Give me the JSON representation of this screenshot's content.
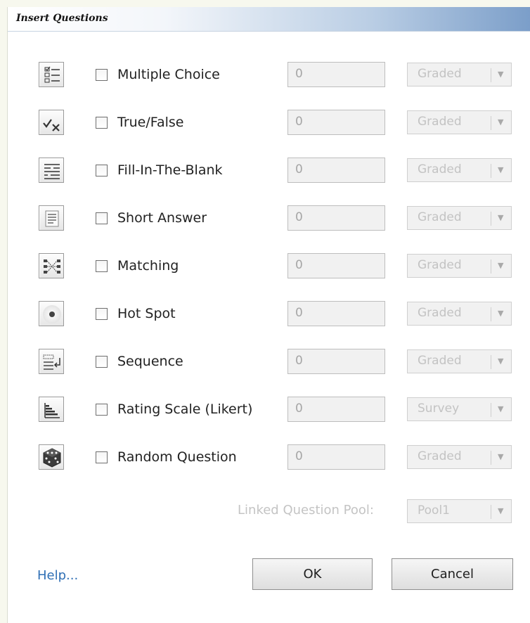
{
  "window": {
    "title": "Insert Questions"
  },
  "questions": [
    {
      "label": "Multiple Choice",
      "count": "0",
      "mode": "Graded",
      "icon": "multiple-choice-icon"
    },
    {
      "label": "True/False",
      "count": "0",
      "mode": "Graded",
      "icon": "true-false-icon"
    },
    {
      "label": "Fill-In-The-Blank",
      "count": "0",
      "mode": "Graded",
      "icon": "fill-in-the-blank-icon"
    },
    {
      "label": "Short Answer",
      "count": "0",
      "mode": "Graded",
      "icon": "short-answer-icon"
    },
    {
      "label": "Matching",
      "count": "0",
      "mode": "Graded",
      "icon": "matching-icon"
    },
    {
      "label": "Hot Spot",
      "count": "0",
      "mode": "Graded",
      "icon": "hot-spot-icon"
    },
    {
      "label": "Sequence",
      "count": "0",
      "mode": "Graded",
      "icon": "sequence-icon"
    },
    {
      "label": "Rating Scale (Likert)",
      "count": "0",
      "mode": "Survey",
      "icon": "rating-scale-icon"
    },
    {
      "label": "Random Question",
      "count": "0",
      "mode": "Graded",
      "icon": "random-dice-icon"
    }
  ],
  "pool": {
    "label": "Linked Question Pool:",
    "value": "Pool1"
  },
  "footer": {
    "help": "Help...",
    "ok": "OK",
    "cancel": "Cancel"
  },
  "colors": {
    "titlebar_gradient_end": "#7b9ec9",
    "link": "#2f6fb5",
    "disabled_text": "#c3c3c3",
    "page_background": "#f7f8ee"
  }
}
